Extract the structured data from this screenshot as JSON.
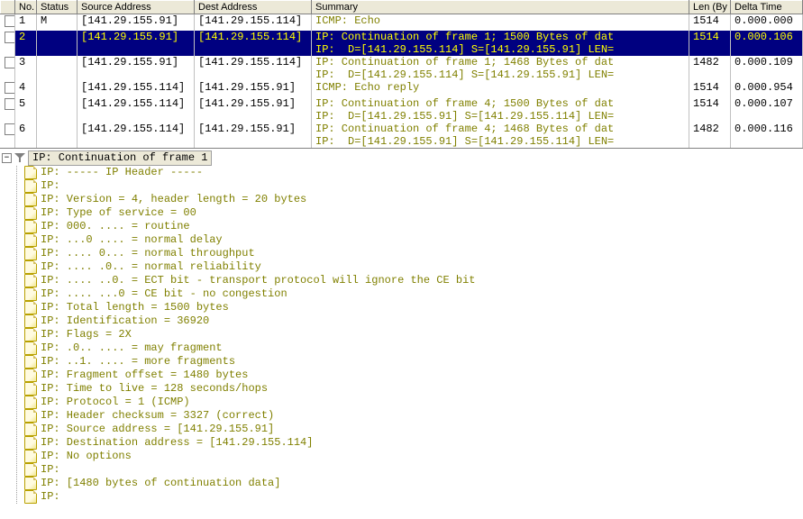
{
  "columns": [
    "",
    "No.",
    "Status",
    "Source Address",
    "Dest Address",
    "Summary",
    "Len (By",
    "Delta Time"
  ],
  "rows": [
    {
      "cb": true,
      "no": "1",
      "status": "M",
      "src": "[141.29.155.91]",
      "dst": "[141.29.155.114]",
      "sum1": "ICMP: Echo",
      "sum2": "",
      "len": "1514",
      "delta": "0.000.000",
      "sel": false
    },
    {
      "cb": true,
      "no": "2",
      "status": "",
      "src": "[141.29.155.91]",
      "dst": "[141.29.155.114]",
      "sum1": "IP: Continuation of frame 1; 1500 Bytes of dat",
      "sum2": "IP:  D=[141.29.155.114] S=[141.29.155.91] LEN=",
      "len": "1514",
      "delta": "0.000.106",
      "sel": true
    },
    {
      "cb": true,
      "no": "3",
      "status": "",
      "src": "[141.29.155.91]",
      "dst": "[141.29.155.114]",
      "sum1": "IP: Continuation of frame 1; 1468 Bytes of dat",
      "sum2": "IP:  D=[141.29.155.114] S=[141.29.155.91] LEN=",
      "len": "1482",
      "delta": "0.000.109",
      "sel": false
    },
    {
      "cb": true,
      "no": "4",
      "status": "",
      "src": "[141.29.155.114]",
      "dst": "[141.29.155.91]",
      "sum1": "ICMP: Echo reply",
      "sum2": "",
      "len": "1514",
      "delta": "0.000.954",
      "sel": false
    },
    {
      "cb": true,
      "no": "5",
      "status": "",
      "src": "[141.29.155.114]",
      "dst": "[141.29.155.91]",
      "sum1": "IP: Continuation of frame 4; 1500 Bytes of dat",
      "sum2": "IP:  D=[141.29.155.91] S=[141.29.155.114] LEN=",
      "len": "1514",
      "delta": "0.000.107",
      "sel": false
    },
    {
      "cb": true,
      "no": "6",
      "status": "",
      "src": "[141.29.155.114]",
      "dst": "[141.29.155.91]",
      "sum1": "IP: Continuation of frame 4; 1468 Bytes of dat",
      "sum2": "IP:  D=[141.29.155.91] S=[141.29.155.114] LEN=",
      "len": "1482",
      "delta": "0.000.116",
      "sel": false
    }
  ],
  "detail": {
    "root": "IP: Continuation of frame 1",
    "lines": [
      "IP: ----- IP Header -----",
      "IP:",
      "IP: Version = 4, header length = 20 bytes",
      "IP: Type of service = 00",
      "IP:       000. ....  = routine",
      "IP:       ...0 ....  = normal delay",
      "IP:       .... 0...  = normal throughput",
      "IP:       .... .0..  = normal reliability",
      "IP:       .... ..0.  = ECT bit - transport protocol will ignore the CE bit",
      "IP:       .... ...0  = CE bit - no congestion",
      "IP: Total length    = 1500 bytes",
      "IP: Identification  = 36920",
      "IP: Flags           = 2X",
      "IP:       .0.. ....  = may fragment",
      "IP:       ..1. ....  = more fragments",
      "IP: Fragment offset = 1480 bytes",
      "IP: Time to live    = 128 seconds/hops",
      "IP: Protocol        = 1 (ICMP)",
      "IP: Header checksum = 3327 (correct)",
      "IP: Source address      = [141.29.155.91]",
      "IP: Destination address = [141.29.155.114]",
      "IP: No options",
      "IP:",
      "IP: [1480 bytes of continuation data]",
      "IP:"
    ]
  }
}
